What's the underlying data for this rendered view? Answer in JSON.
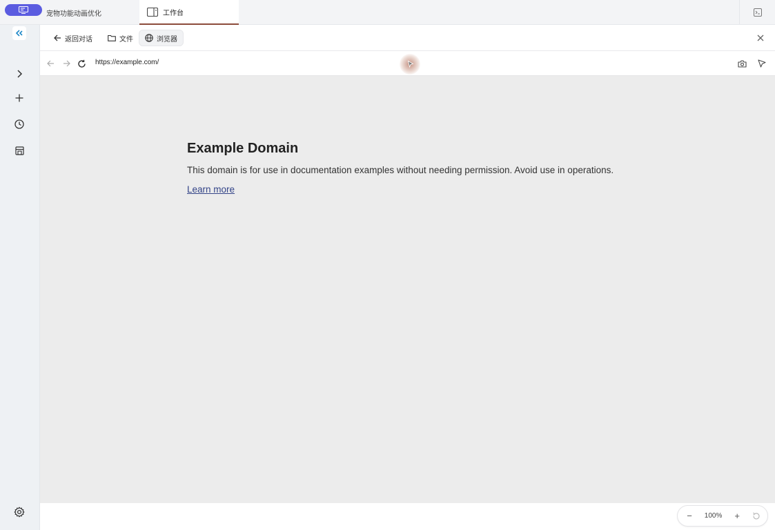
{
  "tabs": {
    "app_icon": "app-window-icon",
    "chat_tab_label": "宠物功能动画优化",
    "workbench_tab_label": "工作台"
  },
  "workbench": {
    "back_label": "返回对话",
    "files_label": "文件",
    "browser_label": "浏览器"
  },
  "browser": {
    "url": "https://example.com/"
  },
  "page": {
    "title": "Example Domain",
    "body": "This domain is for use in documentation examples without needing permission. Avoid use in operations.",
    "link": "Learn more"
  },
  "zoom": {
    "minus": "−",
    "level": "100%",
    "plus": "+"
  },
  "colors": {
    "accent": "#5b5ce0",
    "active_tab_underline": "#8b4a3a"
  }
}
